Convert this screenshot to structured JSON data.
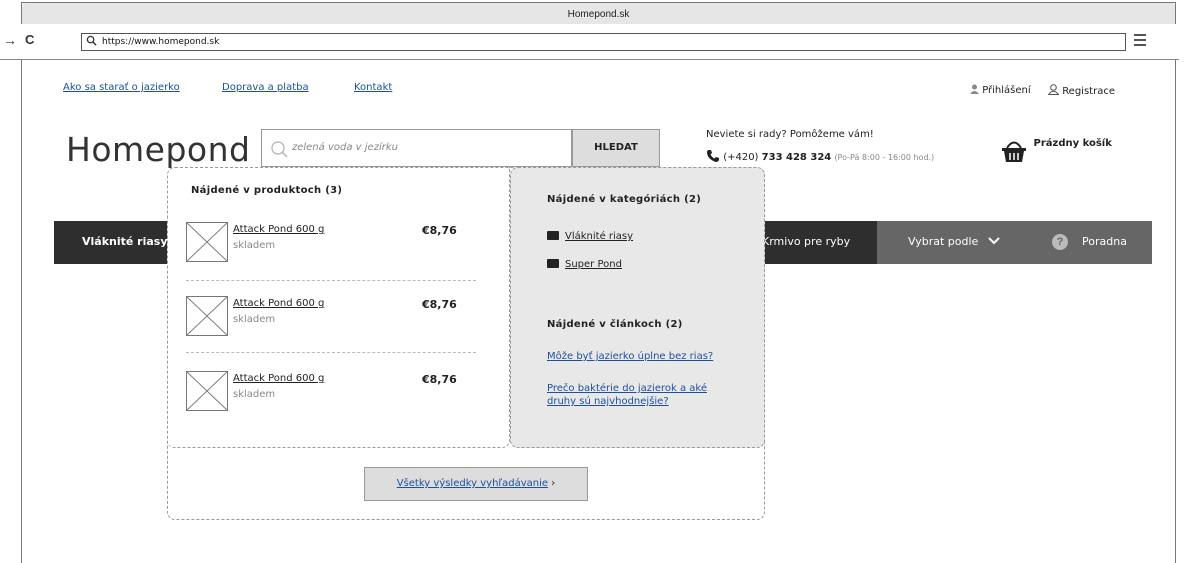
{
  "browser": {
    "title": "Homepond.sk",
    "url": "https://www.homepond.sk",
    "back_icon": "←",
    "forward_icon": "→",
    "reload_icon": "C"
  },
  "top_links": [
    "Ako sa starať o jazierko",
    "Doprava a platba",
    "Kontakt"
  ],
  "account": {
    "login": "Přihlášení",
    "register": "Registrace"
  },
  "logo": "Homepond",
  "search": {
    "placeholder": "zelená voda v jezírku",
    "button": "HLEDAT"
  },
  "help": {
    "question": "Neviete si rady? Pomôžeme vám!",
    "phone_prefix": "(+420)",
    "phone": "733 428 324",
    "hours": "(Po-Pá 8:00 - 16:00 hod.)"
  },
  "cart": {
    "label": "Prázdny košík"
  },
  "nav": {
    "first": "Vláknité riasy",
    "middle": "Krmivo pre ryby",
    "select": "Vybrat podle",
    "advice": "Poradna"
  },
  "dropdown": {
    "products_title": "Nájdené v produktoch (3)",
    "products": [
      {
        "name": "Attack Pond 600 g",
        "stock": "skladem",
        "price": "€8,76"
      },
      {
        "name": "Attack Pond 600 g",
        "stock": "skladem",
        "price": "€8,76"
      },
      {
        "name": "Attack Pond 600 g",
        "stock": "skladem",
        "price": "€8,76"
      }
    ],
    "categories_title": "Nájdené v kategóriách (2)",
    "categories": [
      "Vláknité riasy",
      "Super Pond"
    ],
    "articles_title": "Nájdené v článkoch (2)",
    "articles": [
      "Môže byť jazierko úplne bez rias?",
      "Prečo baktérie do jazierok a aké druhy sú najvhodnejšie?"
    ],
    "all_results": "Všetky výsledky vyhľadávanie",
    "all_results_arrow": "›"
  }
}
